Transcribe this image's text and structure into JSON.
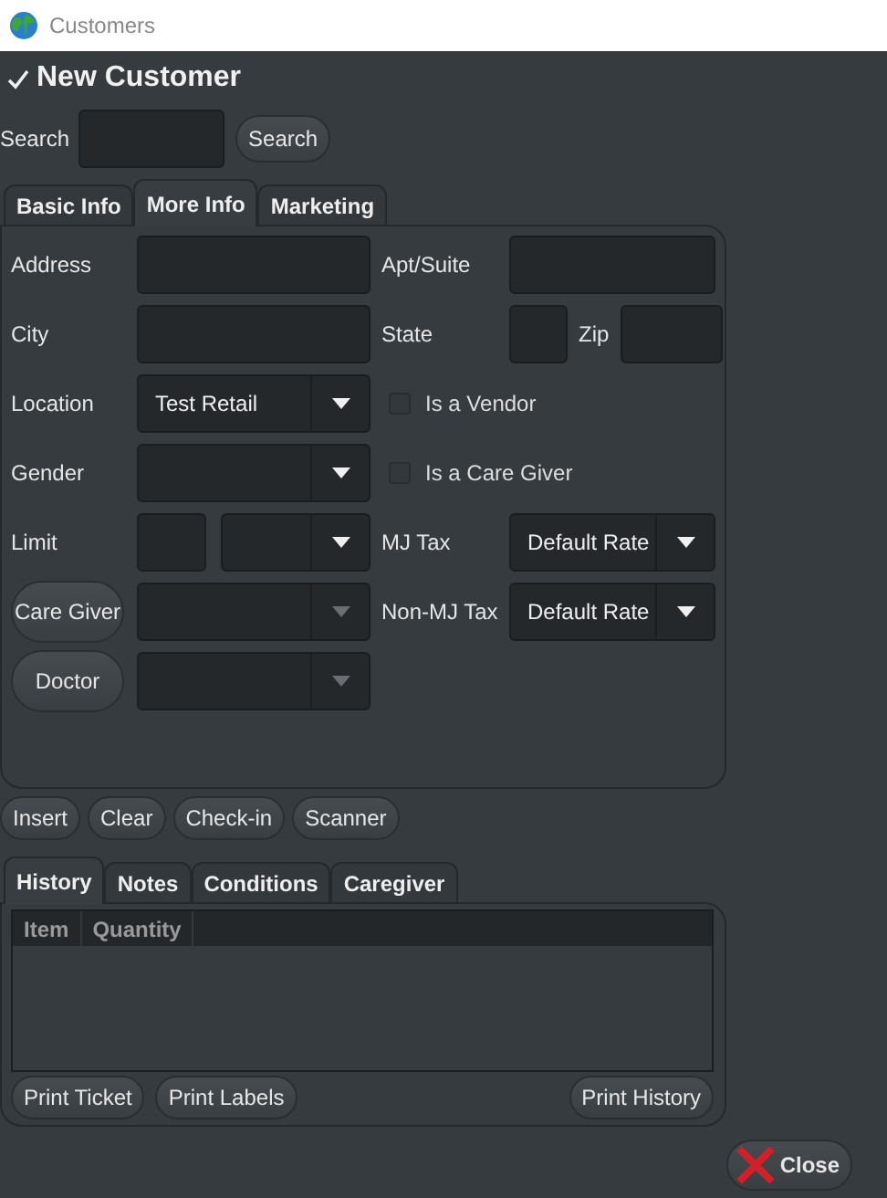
{
  "window": {
    "title": "Customers"
  },
  "header": {
    "title": "New Customer"
  },
  "search": {
    "label": "Search",
    "button": "Search"
  },
  "tabs": [
    {
      "label": "Basic Info",
      "selected": false
    },
    {
      "label": "More Info",
      "selected": true
    },
    {
      "label": "Marketing",
      "selected": false
    }
  ],
  "form_rows": [
    {
      "left": {
        "kind": "text",
        "label": "Address"
      },
      "right": {
        "kind": "text",
        "label": "Apt/Suite"
      }
    },
    {
      "left": {
        "kind": "text",
        "label": "City"
      },
      "right": {
        "kind": "state_zip",
        "label": "State",
        "label_2": "Zip"
      }
    },
    {
      "left": {
        "kind": "select",
        "label": "Location",
        "value": "Test Retail",
        "disabled": false
      },
      "right": {
        "kind": "checkbox",
        "label": "Is a Vendor",
        "checked": false
      }
    },
    {
      "left": {
        "kind": "select",
        "label": "Gender",
        "disabled": false
      },
      "right": {
        "kind": "checkbox",
        "label": "Is a Care Giver",
        "checked": false
      }
    },
    {
      "left": {
        "kind": "limit",
        "label": "Limit",
        "disabled": false
      },
      "right": {
        "kind": "select",
        "label": "MJ Tax",
        "value": "Default Rate",
        "disabled": false
      }
    },
    {
      "left": {
        "kind": "button_select",
        "label": "Care Giver",
        "disabled": true
      },
      "right": {
        "kind": "select",
        "label": "Non-MJ Tax",
        "value": "Default Rate",
        "disabled": false
      }
    },
    {
      "left": {
        "kind": "button_select",
        "label": "Doctor",
        "disabled": true
      }
    }
  ],
  "actions": [
    "Insert",
    "Clear",
    "Check-in",
    "Scanner"
  ],
  "bottom_tabs": [
    {
      "label": "History",
      "selected": true
    },
    {
      "label": "Notes",
      "selected": false
    },
    {
      "label": "Conditions",
      "selected": false
    },
    {
      "label": "Caregiver",
      "selected": false
    }
  ],
  "table": {
    "columns": [
      "Item",
      "Quantity"
    ]
  },
  "print_buttons": [
    "Print Ticket",
    "Print Labels",
    "Print History"
  ],
  "close_button": "Close"
}
